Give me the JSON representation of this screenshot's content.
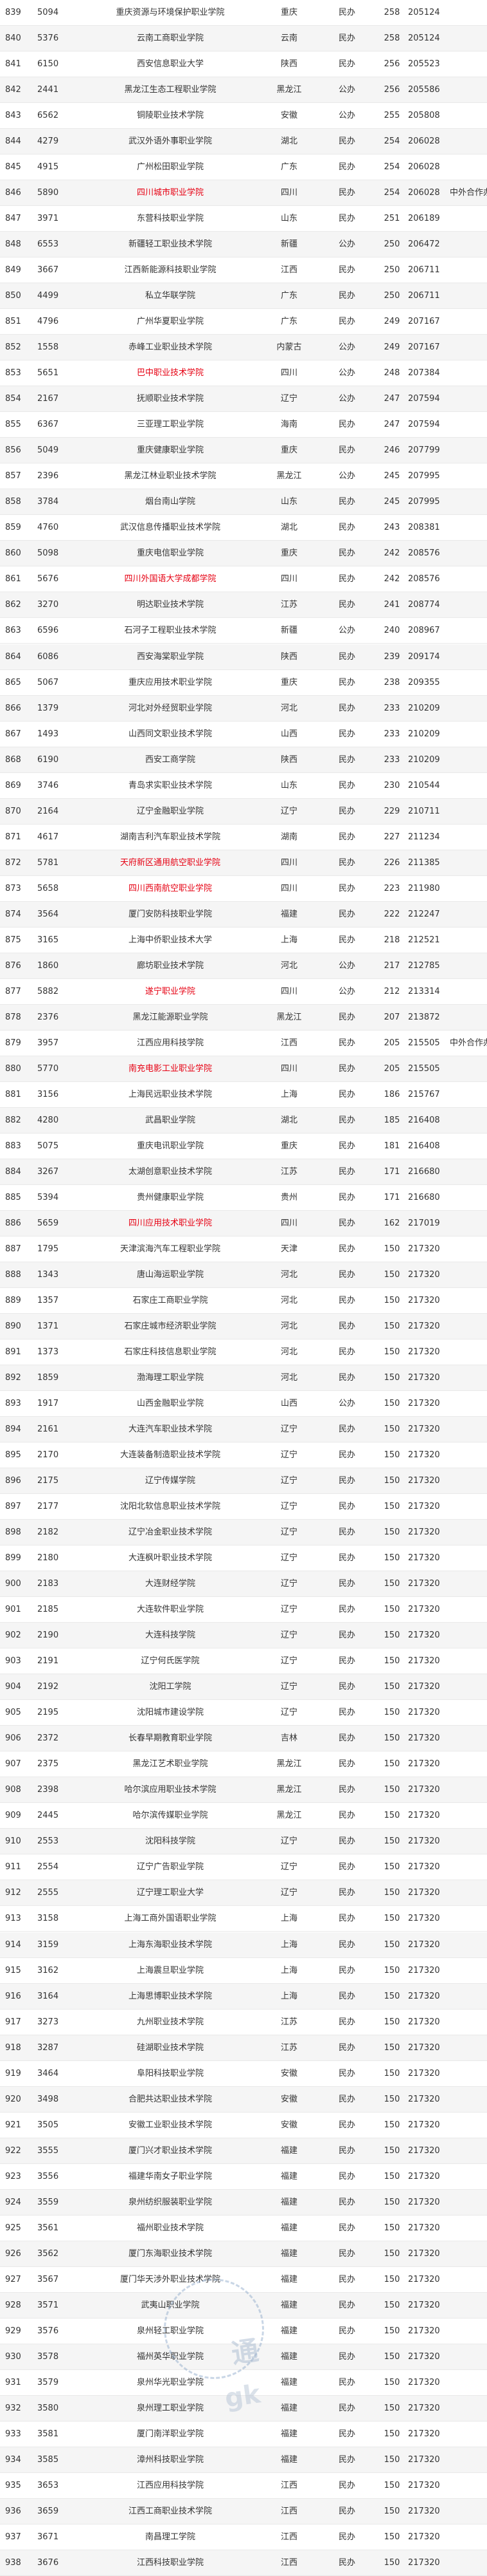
{
  "rows": [
    [
      "839",
      "5094",
      "重庆资源与环境保护职业学院",
      "重庆",
      "民办",
      "258",
      "205124",
      ""
    ],
    [
      "840",
      "5376",
      "云南工商职业学院",
      "云南",
      "民办",
      "258",
      "205124",
      ""
    ],
    [
      "841",
      "6150",
      "西安信息职业大学",
      "陕西",
      "民办",
      "256",
      "205523",
      ""
    ],
    [
      "842",
      "2441",
      "黑龙江生态工程职业学院",
      "黑龙江",
      "公办",
      "256",
      "205586",
      ""
    ],
    [
      "843",
      "6562",
      "铜陵职业技术学院",
      "安徽",
      "公办",
      "255",
      "205808",
      ""
    ],
    [
      "844",
      "4279",
      "武汉外语外事职业学院",
      "湖北",
      "民办",
      "254",
      "206028",
      ""
    ],
    [
      "845",
      "4915",
      "广州松田职业学院",
      "广东",
      "民办",
      "254",
      "206028",
      ""
    ],
    [
      "846",
      "5890",
      "四川城市职业学院",
      "四川",
      "民办",
      "254",
      "206028",
      "中外合作办学"
    ],
    [
      "847",
      "3971",
      "东营科技职业学院",
      "山东",
      "民办",
      "251",
      "206189",
      ""
    ],
    [
      "848",
      "6553",
      "新疆轻工职业技术学院",
      "新疆",
      "公办",
      "250",
      "206472",
      ""
    ],
    [
      "849",
      "3667",
      "江西新能源科技职业学院",
      "江西",
      "民办",
      "250",
      "206711",
      ""
    ],
    [
      "850",
      "4499",
      "私立华联学院",
      "广东",
      "民办",
      "250",
      "206711",
      ""
    ],
    [
      "851",
      "4796",
      "广州华夏职业学院",
      "广东",
      "民办",
      "249",
      "207167",
      ""
    ],
    [
      "852",
      "1558",
      "赤峰工业职业技术学院",
      "内蒙古",
      "公办",
      "249",
      "207167",
      ""
    ],
    [
      "853",
      "5651",
      "巴中职业技术学院",
      "四川",
      "公办",
      "248",
      "207384",
      ""
    ],
    [
      "854",
      "2167",
      "抚顺职业技术学院",
      "辽宁",
      "公办",
      "247",
      "207594",
      ""
    ],
    [
      "855",
      "6367",
      "三亚理工职业学院",
      "海南",
      "民办",
      "247",
      "207594",
      ""
    ],
    [
      "856",
      "5049",
      "重庆健康职业学院",
      "重庆",
      "民办",
      "246",
      "207799",
      ""
    ],
    [
      "857",
      "2396",
      "黑龙江林业职业技术学院",
      "黑龙江",
      "公办",
      "245",
      "207995",
      ""
    ],
    [
      "858",
      "3784",
      "烟台南山学院",
      "山东",
      "民办",
      "245",
      "207995",
      ""
    ],
    [
      "859",
      "4760",
      "武汉信息传播职业技术学院",
      "湖北",
      "民办",
      "243",
      "208381",
      ""
    ],
    [
      "860",
      "5098",
      "重庆电信职业学院",
      "重庆",
      "民办",
      "242",
      "208576",
      ""
    ],
    [
      "861",
      "5676",
      "四川外国语大学成都学院",
      "四川",
      "民办",
      "242",
      "208576",
      ""
    ],
    [
      "862",
      "3270",
      "明达职业技术学院",
      "江苏",
      "民办",
      "241",
      "208774",
      ""
    ],
    [
      "863",
      "6596",
      "石河子工程职业技术学院",
      "新疆",
      "公办",
      "240",
      "208967",
      ""
    ],
    [
      "864",
      "6086",
      "西安海棠职业学院",
      "陕西",
      "民办",
      "239",
      "209174",
      ""
    ],
    [
      "865",
      "5067",
      "重庆应用技术职业学院",
      "重庆",
      "民办",
      "238",
      "209355",
      ""
    ],
    [
      "866",
      "1379",
      "河北对外经贸职业学院",
      "河北",
      "民办",
      "233",
      "210209",
      ""
    ],
    [
      "867",
      "1493",
      "山西同文职业技术学院",
      "山西",
      "民办",
      "233",
      "210209",
      ""
    ],
    [
      "868",
      "6190",
      "西安工商学院",
      "陕西",
      "民办",
      "233",
      "210209",
      ""
    ],
    [
      "869",
      "3746",
      "青岛求实职业技术学院",
      "山东",
      "民办",
      "230",
      "210544",
      ""
    ],
    [
      "870",
      "2164",
      "辽宁金融职业学院",
      "辽宁",
      "民办",
      "229",
      "210711",
      ""
    ],
    [
      "871",
      "4617",
      "湖南吉利汽车职业技术学院",
      "湖南",
      "民办",
      "227",
      "211234",
      ""
    ],
    [
      "872",
      "5781",
      "天府新区通用航空职业学院",
      "四川",
      "民办",
      "226",
      "211385",
      ""
    ],
    [
      "873",
      "5658",
      "四川西南航空职业学院",
      "四川",
      "民办",
      "223",
      "211980",
      ""
    ],
    [
      "874",
      "3564",
      "厦门安防科技职业学院",
      "福建",
      "民办",
      "222",
      "212247",
      ""
    ],
    [
      "875",
      "3165",
      "上海中侨职业技术大学",
      "上海",
      "民办",
      "218",
      "212521",
      ""
    ],
    [
      "876",
      "1860",
      "廊坊职业技术学院",
      "河北",
      "公办",
      "217",
      "212785",
      ""
    ],
    [
      "877",
      "5882",
      "遂宁职业学院",
      "四川",
      "公办",
      "212",
      "213314",
      ""
    ],
    [
      "878",
      "2376",
      "黑龙江能源职业学院",
      "黑龙江",
      "民办",
      "207",
      "213872",
      ""
    ],
    [
      "879",
      "3957",
      "江西应用科技学院",
      "江西",
      "民办",
      "205",
      "215505",
      "中外合作办学"
    ],
    [
      "880",
      "5770",
      "南充电影工业职业学院",
      "四川",
      "民办",
      "205",
      "215505",
      ""
    ],
    [
      "881",
      "3156",
      "上海民远职业技术学院",
      "上海",
      "民办",
      "186",
      "215767",
      ""
    ],
    [
      "882",
      "4280",
      "武昌职业学院",
      "湖北",
      "民办",
      "185",
      "216408",
      ""
    ],
    [
      "883",
      "5075",
      "重庆电讯职业学院",
      "重庆",
      "民办",
      "181",
      "216408",
      ""
    ],
    [
      "884",
      "3267",
      "太湖创意职业技术学院",
      "江苏",
      "民办",
      "171",
      "216680",
      ""
    ],
    [
      "885",
      "5394",
      "贵州健康职业学院",
      "贵州",
      "民办",
      "171",
      "216680",
      ""
    ],
    [
      "886",
      "5659",
      "四川应用技术职业学院",
      "四川",
      "民办",
      "162",
      "217019",
      ""
    ],
    [
      "887",
      "1795",
      "天津滨海汽车工程职业学院",
      "天津",
      "民办",
      "150",
      "217320",
      ""
    ],
    [
      "888",
      "1343",
      "唐山海运职业学院",
      "河北",
      "民办",
      "150",
      "217320",
      ""
    ],
    [
      "889",
      "1357",
      "石家庄工商职业学院",
      "河北",
      "民办",
      "150",
      "217320",
      ""
    ],
    [
      "890",
      "1371",
      "石家庄城市经济职业学院",
      "河北",
      "民办",
      "150",
      "217320",
      ""
    ],
    [
      "891",
      "1373",
      "石家庄科技信息职业学院",
      "河北",
      "民办",
      "150",
      "217320",
      ""
    ],
    [
      "892",
      "1859",
      "渤海理工职业学院",
      "河北",
      "民办",
      "150",
      "217320",
      ""
    ],
    [
      "893",
      "1917",
      "山西金融职业学院",
      "山西",
      "公办",
      "150",
      "217320",
      ""
    ],
    [
      "894",
      "2161",
      "大连汽车职业技术学院",
      "辽宁",
      "民办",
      "150",
      "217320",
      ""
    ],
    [
      "895",
      "2170",
      "大连装备制造职业技术学院",
      "辽宁",
      "民办",
      "150",
      "217320",
      ""
    ],
    [
      "896",
      "2175",
      "辽宁传媒学院",
      "辽宁",
      "民办",
      "150",
      "217320",
      ""
    ],
    [
      "897",
      "2177",
      "沈阳北软信息职业技术学院",
      "辽宁",
      "民办",
      "150",
      "217320",
      ""
    ],
    [
      "898",
      "2182",
      "辽宁冶金职业技术学院",
      "辽宁",
      "民办",
      "150",
      "217320",
      ""
    ],
    [
      "899",
      "2180",
      "大连枫叶职业技术学院",
      "辽宁",
      "民办",
      "150",
      "217320",
      ""
    ],
    [
      "900",
      "2183",
      "大连财经学院",
      "辽宁",
      "民办",
      "150",
      "217320",
      ""
    ],
    [
      "901",
      "2185",
      "大连软件职业学院",
      "辽宁",
      "民办",
      "150",
      "217320",
      ""
    ],
    [
      "902",
      "2190",
      "大连科技学院",
      "辽宁",
      "民办",
      "150",
      "217320",
      ""
    ],
    [
      "903",
      "2191",
      "辽宁何氏医学院",
      "辽宁",
      "民办",
      "150",
      "217320",
      ""
    ],
    [
      "904",
      "2192",
      "沈阳工学院",
      "辽宁",
      "民办",
      "150",
      "217320",
      ""
    ],
    [
      "905",
      "2195",
      "沈阳城市建设学院",
      "辽宁",
      "民办",
      "150",
      "217320",
      ""
    ],
    [
      "906",
      "2372",
      "长春早期教育职业学院",
      "吉林",
      "民办",
      "150",
      "217320",
      ""
    ],
    [
      "907",
      "2375",
      "黑龙江艺术职业学院",
      "黑龙江",
      "民办",
      "150",
      "217320",
      ""
    ],
    [
      "908",
      "2398",
      "哈尔滨应用职业技术学院",
      "黑龙江",
      "民办",
      "150",
      "217320",
      ""
    ],
    [
      "909",
      "2445",
      "哈尔滨传媒职业学院",
      "黑龙江",
      "民办",
      "150",
      "217320",
      ""
    ],
    [
      "910",
      "2553",
      "沈阳科技学院",
      "辽宁",
      "民办",
      "150",
      "217320",
      ""
    ],
    [
      "911",
      "2554",
      "辽宁广告职业学院",
      "辽宁",
      "民办",
      "150",
      "217320",
      ""
    ],
    [
      "912",
      "2555",
      "辽宁理工职业大学",
      "辽宁",
      "民办",
      "150",
      "217320",
      ""
    ],
    [
      "913",
      "3158",
      "上海工商外国语职业学院",
      "上海",
      "民办",
      "150",
      "217320",
      ""
    ],
    [
      "914",
      "3159",
      "上海东海职业技术学院",
      "上海",
      "民办",
      "150",
      "217320",
      ""
    ],
    [
      "915",
      "3162",
      "上海震旦职业学院",
      "上海",
      "民办",
      "150",
      "217320",
      ""
    ],
    [
      "916",
      "3164",
      "上海思博职业技术学院",
      "上海",
      "民办",
      "150",
      "217320",
      ""
    ],
    [
      "917",
      "3273",
      "九州职业技术学院",
      "江苏",
      "民办",
      "150",
      "217320",
      ""
    ],
    [
      "918",
      "3287",
      "硅湖职业技术学院",
      "江苏",
      "民办",
      "150",
      "217320",
      ""
    ],
    [
      "919",
      "3464",
      "阜阳科技职业学院",
      "安徽",
      "民办",
      "150",
      "217320",
      ""
    ],
    [
      "920",
      "3498",
      "合肥共达职业技术学院",
      "安徽",
      "民办",
      "150",
      "217320",
      ""
    ],
    [
      "921",
      "3505",
      "安徽工业职业技术学院",
      "安徽",
      "民办",
      "150",
      "217320",
      ""
    ],
    [
      "922",
      "3555",
      "厦门兴才职业技术学院",
      "福建",
      "民办",
      "150",
      "217320",
      ""
    ],
    [
      "923",
      "3556",
      "福建华南女子职业学院",
      "福建",
      "民办",
      "150",
      "217320",
      ""
    ],
    [
      "924",
      "3559",
      "泉州纺织服装职业学院",
      "福建",
      "民办",
      "150",
      "217320",
      ""
    ],
    [
      "925",
      "3561",
      "福州职业技术学院",
      "福建",
      "民办",
      "150",
      "217320",
      ""
    ],
    [
      "926",
      "3562",
      "厦门东海职业技术学院",
      "福建",
      "民办",
      "150",
      "217320",
      ""
    ],
    [
      "927",
      "3567",
      "厦门华天涉外职业技术学院",
      "福建",
      "民办",
      "150",
      "217320",
      ""
    ],
    [
      "928",
      "3571",
      "武夷山职业学院",
      "福建",
      "民办",
      "150",
      "217320",
      ""
    ],
    [
      "929",
      "3576",
      "泉州轻工职业学院",
      "福建",
      "民办",
      "150",
      "217320",
      ""
    ],
    [
      "930",
      "3578",
      "福州英华职业学院",
      "福建",
      "民办",
      "150",
      "217320",
      ""
    ],
    [
      "931",
      "3579",
      "泉州华光职业学院",
      "福建",
      "民办",
      "150",
      "217320",
      ""
    ],
    [
      "932",
      "3580",
      "泉州理工职业学院",
      "福建",
      "民办",
      "150",
      "217320",
      ""
    ],
    [
      "933",
      "3581",
      "厦门南洋职业学院",
      "福建",
      "民办",
      "150",
      "217320",
      ""
    ],
    [
      "934",
      "3585",
      "漳州科技职业学院",
      "福建",
      "民办",
      "150",
      "217320",
      ""
    ],
    [
      "935",
      "3653",
      "江西应用科技学院",
      "江西",
      "民办",
      "150",
      "217320",
      ""
    ],
    [
      "936",
      "3659",
      "江西工商职业技术学院",
      "江西",
      "民办",
      "150",
      "217320",
      ""
    ],
    [
      "937",
      "3671",
      "南昌理工学院",
      "江西",
      "民办",
      "150",
      "217320",
      ""
    ],
    [
      "938",
      "3676",
      "江西科技职业学院",
      "江西",
      "民办",
      "150",
      "217320",
      ""
    ]
  ],
  "red_rows": [
    7,
    14,
    22,
    33,
    34,
    38,
    41,
    47
  ],
  "colors": {
    "red_text": "#e60012",
    "text": "#333333",
    "row_alt": "#f5f5f5",
    "border": "#e9e9e9"
  },
  "watermark": {
    "line1": "通",
    "line2": "gk"
  }
}
